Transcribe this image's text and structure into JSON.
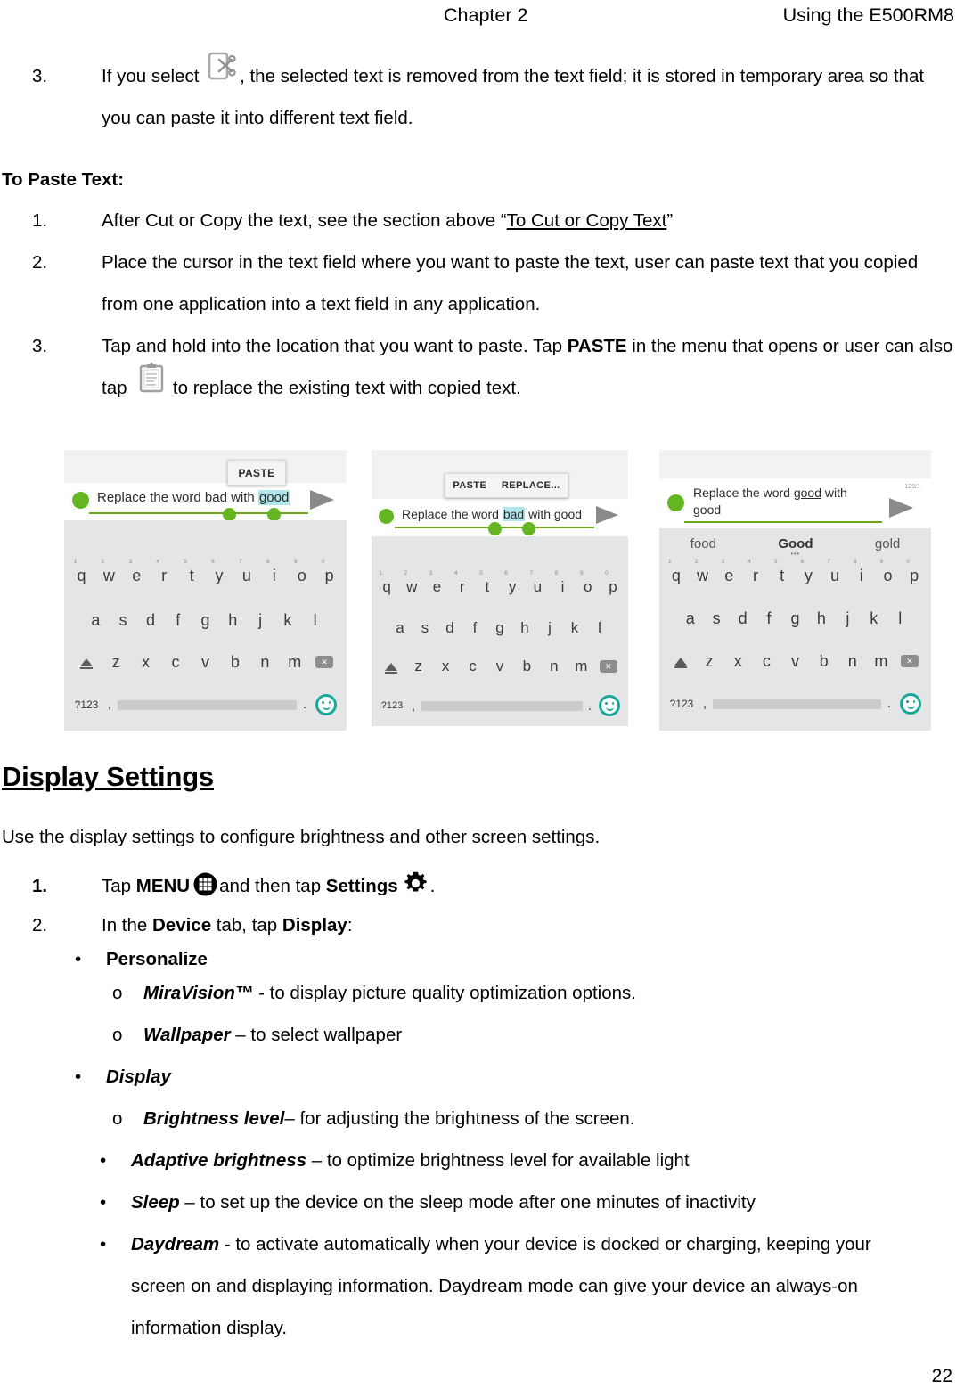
{
  "header": {
    "chapter": "Chapter 2",
    "device": "Using the E500RM8"
  },
  "page_number": "22",
  "cut_step": {
    "marker": "3.",
    "text_before": "If you select",
    "icon": "cut-icon",
    "text_after": ", the selected text is removed from the text field; it is stored in temporary area so that you can paste it into different text field."
  },
  "paste_section": {
    "heading": "To Paste Text:",
    "steps": [
      {
        "marker": "1.",
        "before": "After Cut or Copy the text, see the section above “",
        "link": "To Cut or Copy Text",
        "after": "”"
      },
      {
        "marker": "2.",
        "text": "Place the cursor in the text field where you want to paste the text, user can paste text that you copied from one application into a text field in any application."
      },
      {
        "marker": "3.",
        "before": "Tap and hold into the location that you want to paste. Tap ",
        "bold": "PASTE",
        "middle": " in the menu that opens or user can also tap ",
        "icon": "clipboard-icon",
        "after": " to replace the existing text with copied text."
      }
    ]
  },
  "figures": [
    {
      "name": "paste-menu-screenshot",
      "popup_buttons": [
        "PASTE"
      ],
      "message": {
        "prefix": "Replace the word bad with ",
        "highlighted": "good",
        "suffix": ""
      },
      "suggestions": [],
      "counter": "",
      "keyboard": {
        "row1": [
          "q",
          "w",
          "e",
          "r",
          "t",
          "y",
          "u",
          "i",
          "o",
          "p"
        ],
        "row1_numbers": [
          "1",
          "2",
          "3",
          "4",
          "5",
          "6",
          "7",
          "8",
          "9",
          "0"
        ],
        "row2": [
          "a",
          "s",
          "d",
          "f",
          "g",
          "h",
          "j",
          "k",
          "l"
        ],
        "row3": [
          "z",
          "x",
          "c",
          "v",
          "b",
          "n",
          "m"
        ],
        "symbols_key": "?123",
        "comma_key": ",",
        "period_key": "."
      }
    },
    {
      "name": "paste-replace-menu-screenshot",
      "popup_buttons": [
        "PASTE",
        "REPLACE..."
      ],
      "message": {
        "prefix": "Replace the word ",
        "highlighted": "bad",
        "suffix": " with good"
      },
      "suggestions": [],
      "counter": "",
      "keyboard": {
        "row1": [
          "q",
          "w",
          "e",
          "r",
          "t",
          "y",
          "u",
          "i",
          "o",
          "p"
        ],
        "row1_numbers": [
          "1",
          "2",
          "3",
          "4",
          "5",
          "6",
          "7",
          "8",
          "9",
          "0"
        ],
        "row2": [
          "a",
          "s",
          "d",
          "f",
          "g",
          "h",
          "j",
          "k",
          "l"
        ],
        "row3": [
          "z",
          "x",
          "c",
          "v",
          "b",
          "n",
          "m"
        ],
        "symbols_key": "?123",
        "comma_key": ",",
        "period_key": "."
      }
    },
    {
      "name": "replaced-text-screenshot",
      "popup_buttons": [],
      "message": {
        "line1_prefix": "Replace the word ",
        "line1_underlined": "good",
        "line1_suffix": " with",
        "line2": "good"
      },
      "suggestions": [
        "food",
        "Good",
        "gold"
      ],
      "selected_suggestion": "Good",
      "counter": "129/1",
      "keyboard": {
        "row1": [
          "q",
          "w",
          "e",
          "r",
          "t",
          "y",
          "u",
          "i",
          "o",
          "p"
        ],
        "row1_numbers": [
          "1",
          "2",
          "3",
          "4",
          "5",
          "6",
          "7",
          "8",
          "9",
          "0"
        ],
        "row2": [
          "a",
          "s",
          "d",
          "f",
          "g",
          "h",
          "j",
          "k",
          "l"
        ],
        "row3": [
          "z",
          "x",
          "c",
          "v",
          "b",
          "n",
          "m"
        ],
        "symbols_key": "?123",
        "comma_key": ",",
        "period_key": "."
      }
    }
  ],
  "display_settings": {
    "heading": "Display Settings",
    "intro": "Use the display settings to configure brightness and other screen settings.",
    "step1": {
      "marker": "1.",
      "before": "Tap ",
      "menu_label": "MENU",
      "middle": "and then tap ",
      "settings_label": "Settings",
      "after": "."
    },
    "step2": {
      "marker": "2.",
      "before": "In the ",
      "device_label": "Device",
      "middle": " tab, tap ",
      "display_label": "Display",
      "after": ":"
    },
    "items": [
      {
        "level": 1,
        "bullet": "•",
        "title": "Personalize",
        "title_style": "bold",
        "desc": ""
      },
      {
        "level": 2,
        "bullet": "o",
        "title": "MiraVision™",
        "title_style": "bold-italic",
        "desc": " - to display picture quality optimization options."
      },
      {
        "level": 2,
        "bullet": "o",
        "title": "Wallpaper",
        "title_style": "bold-italic",
        "desc": " – to select wallpaper"
      },
      {
        "level": 1,
        "bullet": "•",
        "title": "Display",
        "title_style": "bold-italic",
        "desc": ""
      },
      {
        "level": 2,
        "bullet": "o",
        "title": "Brightness level",
        "title_style": "bold-italic",
        "desc": "– for adjusting the brightness of the screen."
      },
      {
        "level": 2,
        "bullet": "•",
        "title": "Adaptive brightness",
        "title_style": "bold-italic",
        "desc": " – to optimize brightness level for available light"
      },
      {
        "level": 2,
        "bullet": "•",
        "title": "Sleep",
        "title_style": "bold-italic",
        "desc": " – to set up the device on the sleep mode after one minutes of inactivity"
      },
      {
        "level": 2,
        "bullet": "•",
        "title": "Daydream",
        "title_style": "bold-italic",
        "desc": " - to activate automatically when your device is docked or charging, keeping your screen on and displaying information. Daydream mode can give your device an always-on information display."
      }
    ]
  }
}
